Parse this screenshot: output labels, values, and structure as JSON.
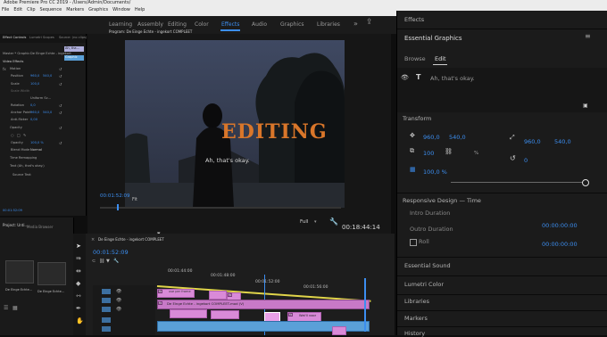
{
  "app": {
    "title": "Adobe Premiere Pro CC 2019 - /Users/Admin/Documents/",
    "menu": [
      "File",
      "Edit",
      "Clip",
      "Sequence",
      "Markers",
      "Graphics",
      "Window",
      "Help"
    ]
  },
  "workspaces": {
    "items": [
      "Learning",
      "Assembly",
      "Editing",
      "Color",
      "Effects",
      "Audio",
      "Graphics",
      "Libraries"
    ],
    "active": "Effects"
  },
  "effect_controls": {
    "tabs": [
      "Effect Controls",
      "Lumetri Scopes",
      "Source: (no clips)"
    ],
    "master": "Master * Graphic",
    "sequence": "De Einge Echte - ingekort",
    "section_video": "Video Effects",
    "motion": "Motion",
    "position_label": "Position",
    "position_x": "960,0",
    "position_y": "540,0",
    "scale_label": "Scale",
    "scale_value": "100,0",
    "scale_width_label": "Scale Width",
    "uniform_scale_label": "Uniform Sc...",
    "rotation_label": "Rotation",
    "rotation_value": "0,0",
    "anchor_label": "Anchor Point",
    "anchor_x": "960,0",
    "anchor_y": "540,0",
    "flicker_label": "Anti-flicker",
    "flicker_value": "0,00",
    "opacity_label": "Opacity",
    "opacity_value": "100,0 %",
    "blend_label": "Blend Mode",
    "blend_value": "Normal",
    "time_remap": "Time Remapping",
    "text_label": "Text (Ah, that's okay.)",
    "source_text": "Source Text",
    "timecode": "00:01:52:09",
    "clip_chip": "Ah, tha...",
    "clip_chip2": "Graphic"
  },
  "program": {
    "tab_label": "Program: De Einge Echte - ingekort COMPLEET",
    "overlay_title": "EDITING",
    "subtitle": "Ah, that's okay.",
    "timecode_in": "00:01:52:09",
    "fit": "Fit",
    "quality": "Full",
    "duration": "00:18:44:14"
  },
  "essential_graphics": {
    "effects_label": "Effects",
    "panel_title": "Essential Graphics",
    "tabs": [
      "Browse",
      "Edit"
    ],
    "active_tab": "Edit",
    "layer_text": "Ah, that's okay.",
    "transform_label": "Transform",
    "pos_x": "960,0",
    "pos_y": "540,0",
    "anchor_x": "960,0",
    "anchor_y": "540,0",
    "opacity_value": "100",
    "scale_percent_sign": "%",
    "rotation_value": "0",
    "scale_value": "100,0 %",
    "responsive_label": "Responsive Design — Time",
    "intro_label": "Intro Duration",
    "intro_value": "00:00:00:00",
    "outro_label": "Outro Duration",
    "outro_value": "00:00:00:00",
    "roll_label": "Roll",
    "sections": [
      "Essential Sound",
      "Lumetri Color",
      "Libraries",
      "Markers",
      "History"
    ]
  },
  "project": {
    "tabs": [
      "Project: Unti...",
      "Media Browser"
    ],
    "items": [
      "De Einge Echte...",
      "De Einge Echte..."
    ]
  },
  "timeline": {
    "tab_label": "De Einge Echte - ingekort COMPLEET",
    "timecode": "00:01:52:09",
    "ruler": [
      "00:01:44:00",
      "00:01:48:00",
      "00:01:52:00",
      "00:01:56:00"
    ],
    "clip_top": "use per frame",
    "clip_main": "De Einge Echte - ingekort COMPLEET-mod (V)",
    "clip_right": "Wat'll voor"
  },
  "colors": {
    "accent": "#3c8ef0",
    "clip_pink": "#d98ad8",
    "clip_blue": "#5aa0d8",
    "title_orange": "#d9762a"
  }
}
